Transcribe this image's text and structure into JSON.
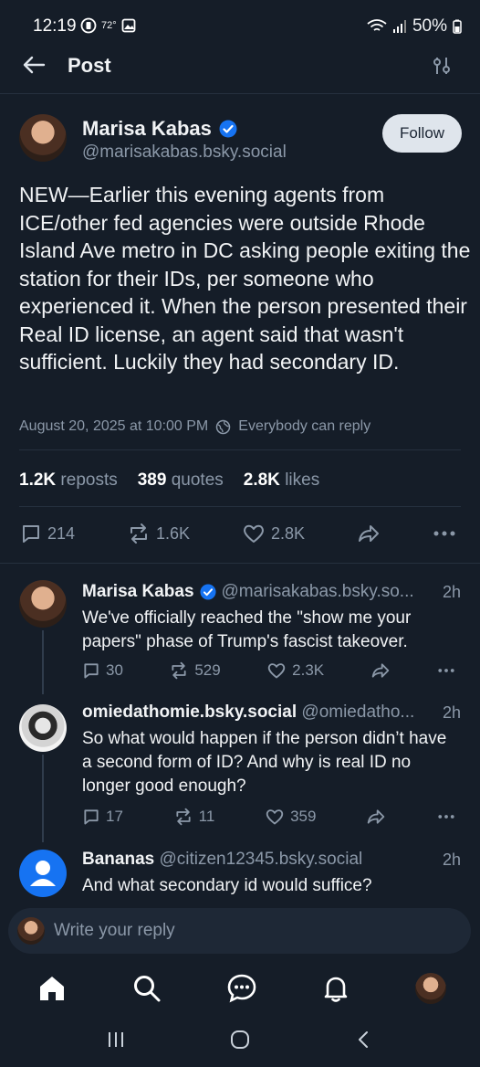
{
  "status_bar": {
    "time": "12:19",
    "temperature": "72°",
    "battery": "50%"
  },
  "header": {
    "title": "Post",
    "icons": [
      "back-arrow-icon",
      "filter-sliders-icon"
    ]
  },
  "main_post": {
    "author_name": "Marisa Kabas",
    "author_handle": "@marisakabas.bsky.social",
    "verified": true,
    "follow_label": "Follow",
    "text": "NEW—Earlier this evening agents from ICE/other fed agencies were outside Rhode Island Ave metro in DC asking people exiting the station for their IDs, per someone who experienced it. When the person presented their Real ID license, an agent said that wasn't sufficient. Luckily they had secondary ID.",
    "timestamp": "August 20, 2025 at 10:00 PM",
    "reply_setting": "Everybody can reply",
    "stats": {
      "reposts_count": "1.2K",
      "reposts_label": "reposts",
      "quotes_count": "389",
      "quotes_label": "quotes",
      "likes_count": "2.8K",
      "likes_label": "likes"
    },
    "actions": {
      "replies": "214",
      "reposts": "1.6K",
      "likes": "2.8K"
    }
  },
  "replies": [
    {
      "author_name": "Marisa Kabas",
      "verified": true,
      "handle": "@marisakabas.bsky.so...",
      "time": "2h",
      "text": "We've officially reached the \"show me your papers\" phase of Trump's fascist takeover.",
      "replies": "30",
      "reposts": "529",
      "likes": "2.3K"
    },
    {
      "author_name": "omiedathomie.bsky.social",
      "verified": false,
      "handle": "@omiedatho...",
      "time": "2h",
      "text": "So what would happen if the person didn’t have a second form of ID? And why is real ID no longer good enough?",
      "replies": "17",
      "reposts": "11",
      "likes": "359"
    },
    {
      "author_name": "Bananas",
      "verified": false,
      "handle": "@citizen12345.bsky.social",
      "time": "2h",
      "text": "And what secondary id would suffice?"
    }
  ],
  "composer": {
    "placeholder": "Write your reply"
  },
  "bottom_nav": {
    "items": [
      "home-icon",
      "search-icon",
      "chat-icon",
      "notifications-bell-icon",
      "profile-avatar"
    ]
  },
  "system_nav": {
    "items": [
      "recents-icon",
      "home-circle-icon",
      "back-chevron-icon"
    ]
  },
  "colors": {
    "background": "#151d28",
    "accent_blue": "#1673f2",
    "muted_text": "#8b98a8"
  }
}
